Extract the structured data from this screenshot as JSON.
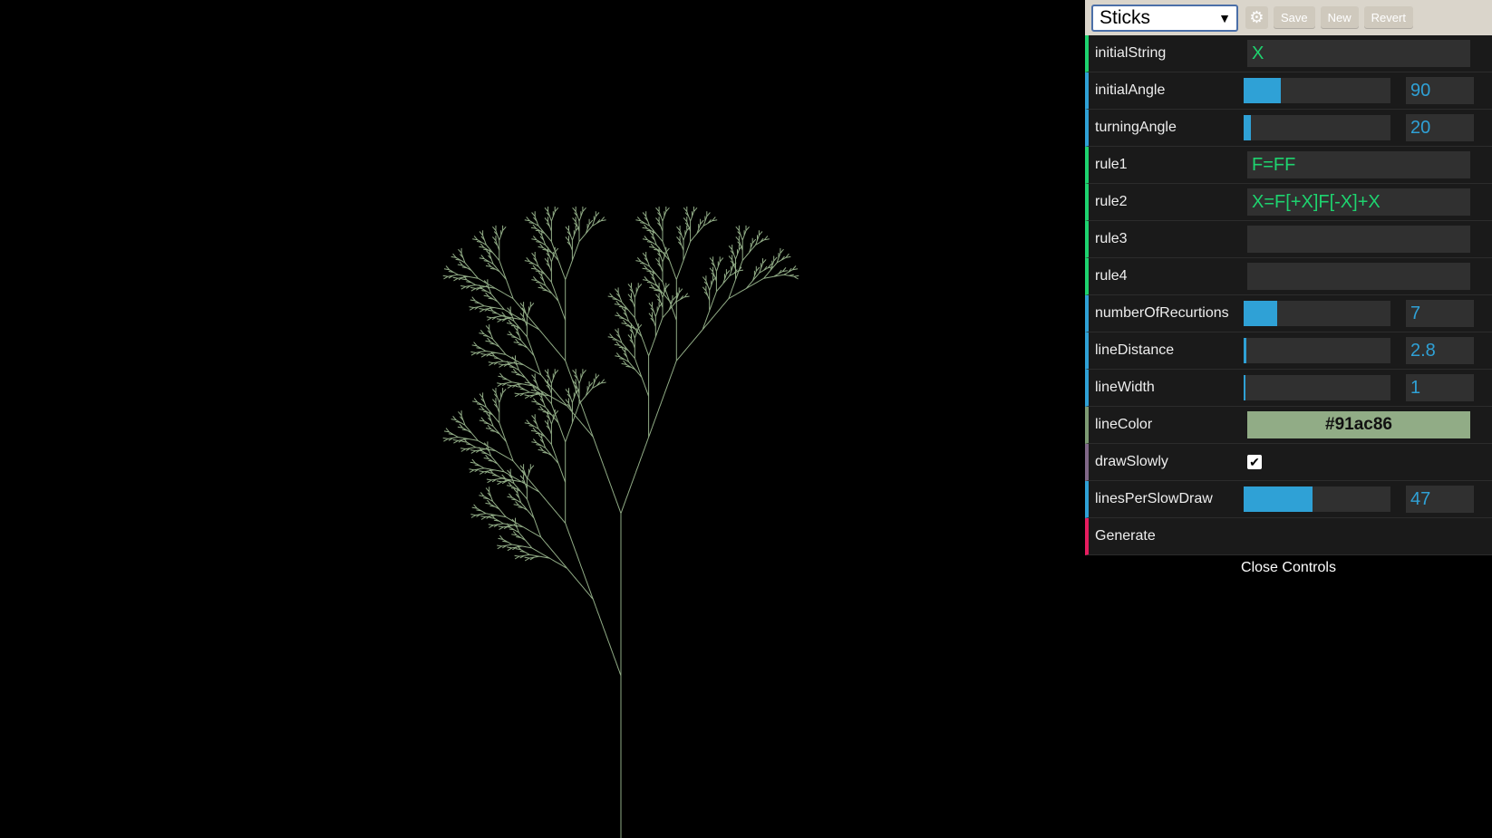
{
  "gui": {
    "preset": "Sticks",
    "buttons": {
      "save": "Save",
      "new": "New",
      "revert": "Revert"
    },
    "controls": {
      "initialString": {
        "label": "initialString",
        "value": "X"
      },
      "initialAngle": {
        "label": "initialAngle",
        "value": "90",
        "fraction": 0.25
      },
      "turningAngle": {
        "label": "turningAngle",
        "value": "20",
        "fraction": 0.05
      },
      "rule1": {
        "label": "rule1",
        "value": "F=FF"
      },
      "rule2": {
        "label": "rule2",
        "value": "X=F[+X]F[-X]+X"
      },
      "rule3": {
        "label": "rule3",
        "value": ""
      },
      "rule4": {
        "label": "rule4",
        "value": ""
      },
      "numberOfRecurtions": {
        "label": "numberOfRecurtions",
        "value": "7",
        "fraction": 0.23
      },
      "lineDistance": {
        "label": "lineDistance",
        "value": "2.8",
        "fraction": 0.02
      },
      "lineWidth": {
        "label": "lineWidth",
        "value": "1",
        "fraction": 0.0
      },
      "lineColor": {
        "label": "lineColor",
        "value": "#91ac86"
      },
      "drawSlowly": {
        "label": "drawSlowly",
        "checked": true
      },
      "linesPerSlowDraw": {
        "label": "linesPerSlowDraw",
        "value": "47",
        "fraction": 0.47
      },
      "generate": {
        "label": "Generate"
      }
    },
    "close_label": "Close Controls"
  },
  "colors": {
    "background": "#000000",
    "tree_line": "#91ac86",
    "slider_fill": "#2fa1d6",
    "string_value": "#1ed36f"
  }
}
